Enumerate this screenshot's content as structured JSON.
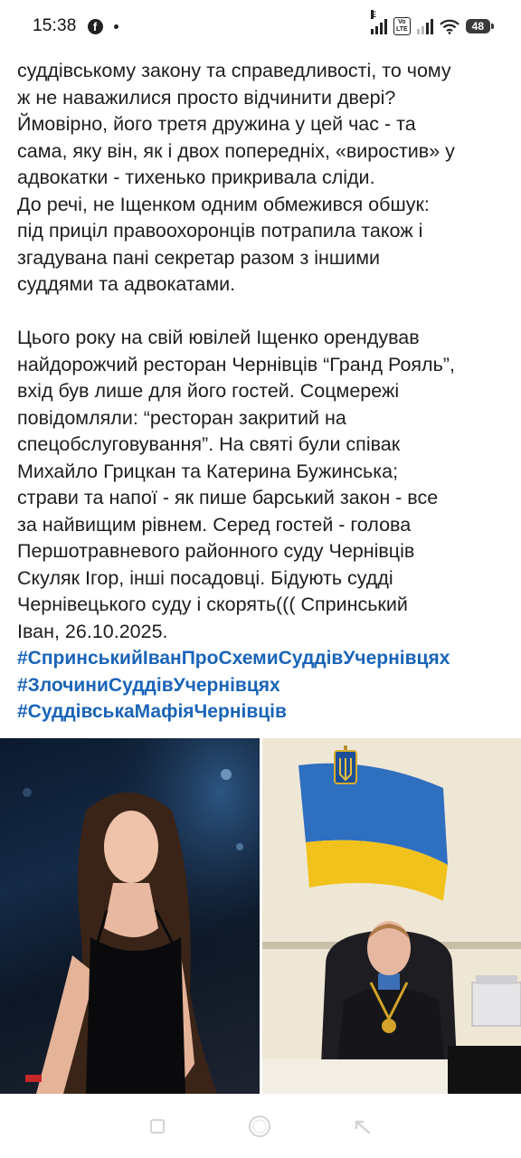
{
  "status_bar": {
    "time": "15:38",
    "app_icon": "facebook-icon",
    "volte_label": "Vo\nLTE",
    "signal_label": "E",
    "battery": "48"
  },
  "post": {
    "paragraph1": [
      "суддівському закону та справедливості, то чому",
      "ж не наважилися просто відчинити двері?",
      "Ймовірно, його третя дружина у цей час - та",
      "сама, яку він, як і двох попередніх, «виростив» у",
      "адвокатки - тихенько прикривала сліди.",
      "До речі, не Іщенком одним обмежився обшук:",
      "під приціл правоохоронців потрапила також і",
      "згадувана пані секретар разом з іншими",
      "суддями та адвокатами."
    ],
    "paragraph2": [
      "Цього року на свій ювілей Іщенко орендував",
      "найдорожчий ресторан Чернівців “Гранд Рояль”,",
      "вхід був лише для його гостей. Соцмережі",
      "повідомляли: “ресторан закритий на",
      "спецобслуговування”. На святі були співак",
      "Михайло Грицкан та Катерина Бужинська;",
      "страви та напої - як пише барський закон -  все",
      "за найвищим рівнем. Серед гостей - голова",
      "Першотравневого районного суду Чернівців",
      "Скуляк Ігор, інші посадовці. Бідують судді",
      "Чернівецького суду і скорять((( Спринський",
      "Іван, 26.10.2025."
    ],
    "hashtags": [
      "#СпринськийІванПроСхемиСуддівУчернівцях",
      "#ЗлочиниСуддівУчернівцях",
      "#СуддівськаМафіяЧернівців"
    ]
  },
  "nav": {
    "recents_icon": "recents-icon",
    "home_icon": "home-icon",
    "back_icon": "back-icon"
  },
  "colors": {
    "hashtag": "#1a64b8",
    "text": "#1c1e21",
    "nav_icons": "#d4d4d4"
  }
}
